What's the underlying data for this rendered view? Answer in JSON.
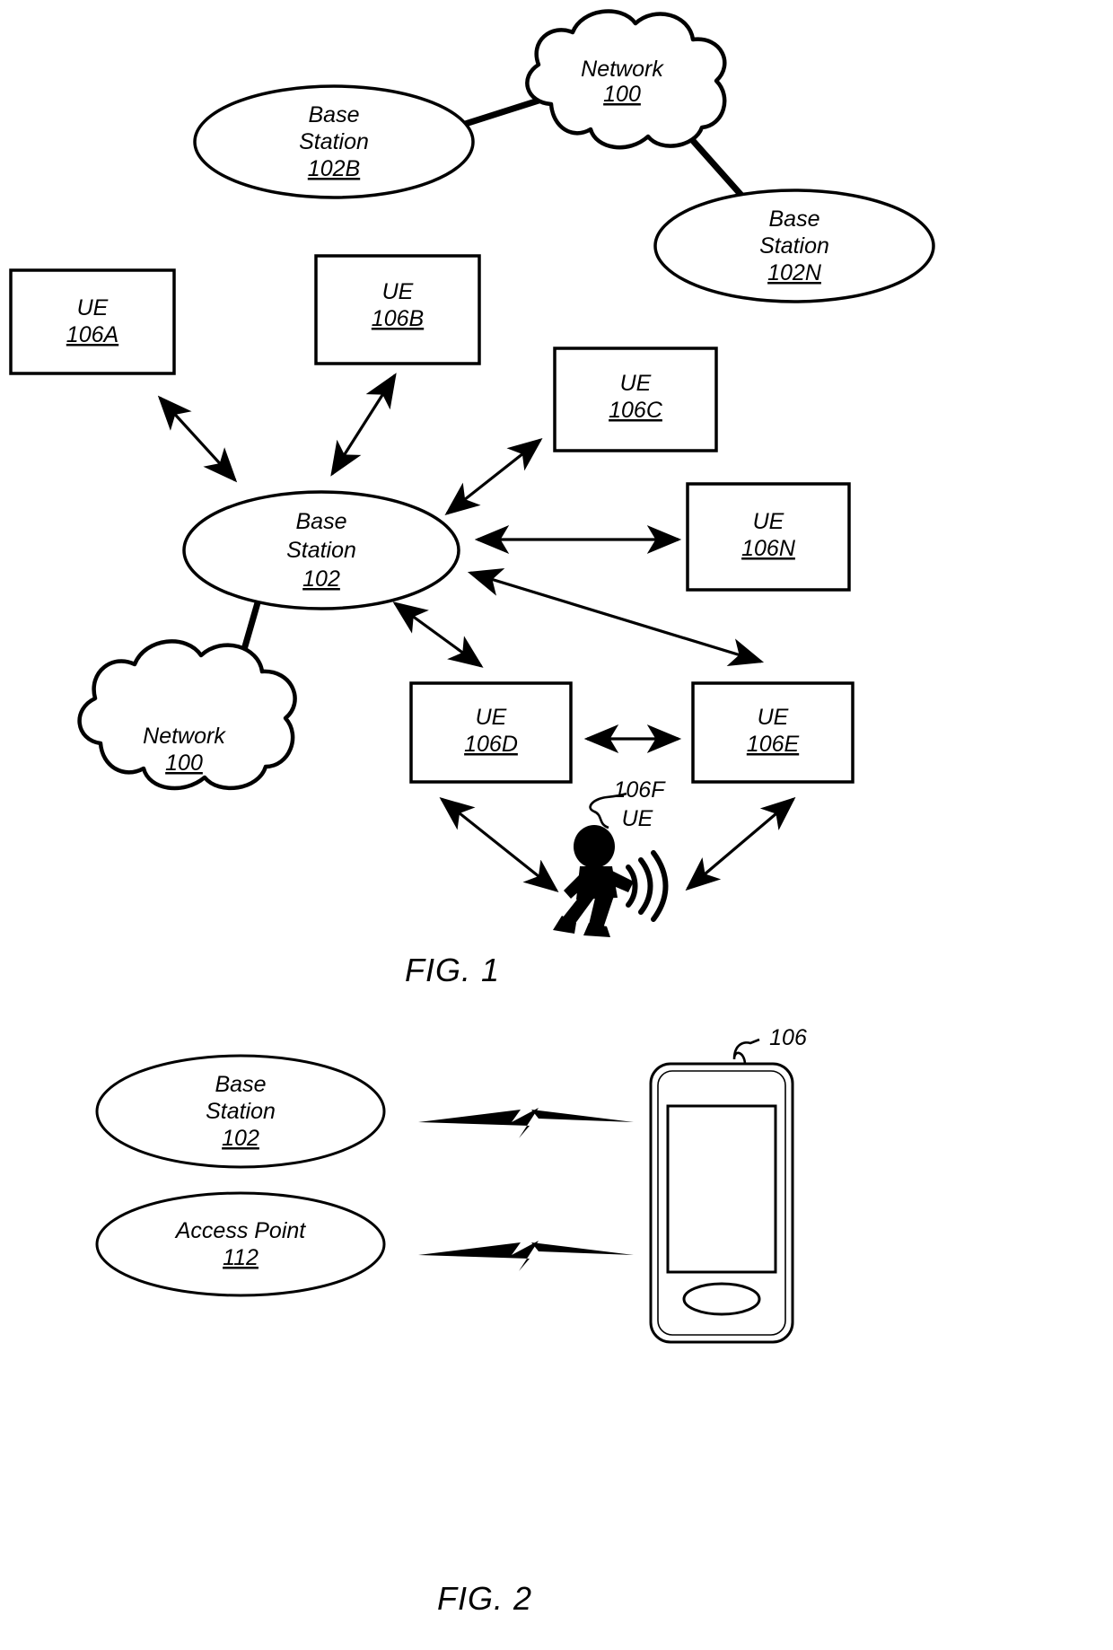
{
  "document": {
    "kind": "patent-figure-sheet",
    "background_color": "#ffffff",
    "ink_color": "#000000"
  },
  "figures": [
    {
      "id": "fig1",
      "caption": "FIG. 1",
      "nodes": [
        {
          "key": "network_top",
          "shape": "cloud",
          "title_line1": "Network",
          "title_line2": "",
          "ref": "100"
        },
        {
          "key": "base_station_102b",
          "shape": "ellipse",
          "title_line1": "Base",
          "title_line2": "Station",
          "ref": "102B"
        },
        {
          "key": "base_station_102n",
          "shape": "ellipse",
          "title_line1": "Base",
          "title_line2": "Station",
          "ref": "102N"
        },
        {
          "key": "ue_106a",
          "shape": "rect",
          "title_line1": "UE",
          "title_line2": "",
          "ref": "106A"
        },
        {
          "key": "ue_106b",
          "shape": "rect",
          "title_line1": "UE",
          "title_line2": "",
          "ref": "106B"
        },
        {
          "key": "ue_106c",
          "shape": "rect",
          "title_line1": "UE",
          "title_line2": "",
          "ref": "106C"
        },
        {
          "key": "ue_106n",
          "shape": "rect",
          "title_line1": "UE",
          "title_line2": "",
          "ref": "106N"
        },
        {
          "key": "base_station_102",
          "shape": "ellipse",
          "title_line1": "Base",
          "title_line2": "Station",
          "ref": "102"
        },
        {
          "key": "network_bottom",
          "shape": "cloud",
          "title_line1": "Network",
          "title_line2": "",
          "ref": "100"
        },
        {
          "key": "ue_106d",
          "shape": "rect",
          "title_line1": "UE",
          "title_line2": "",
          "ref": "106D"
        },
        {
          "key": "ue_106e",
          "shape": "rect",
          "title_line1": "UE",
          "title_line2": "",
          "ref": "106E"
        },
        {
          "key": "ue_106f",
          "shape": "person",
          "title_line1": "UE",
          "title_line2": "",
          "ref": "106F"
        }
      ]
    },
    {
      "id": "fig2",
      "caption": "FIG. 2",
      "nodes": [
        {
          "key": "base_station_102_f2",
          "shape": "ellipse",
          "title_line1": "Base",
          "title_line2": "Station",
          "ref": "102"
        },
        {
          "key": "access_point_112",
          "shape": "ellipse",
          "title_line1": "Access Point",
          "title_line2": "",
          "ref": "112"
        },
        {
          "key": "device_106",
          "shape": "phone",
          "title_line1": "",
          "title_line2": "",
          "ref": "106"
        }
      ]
    }
  ]
}
